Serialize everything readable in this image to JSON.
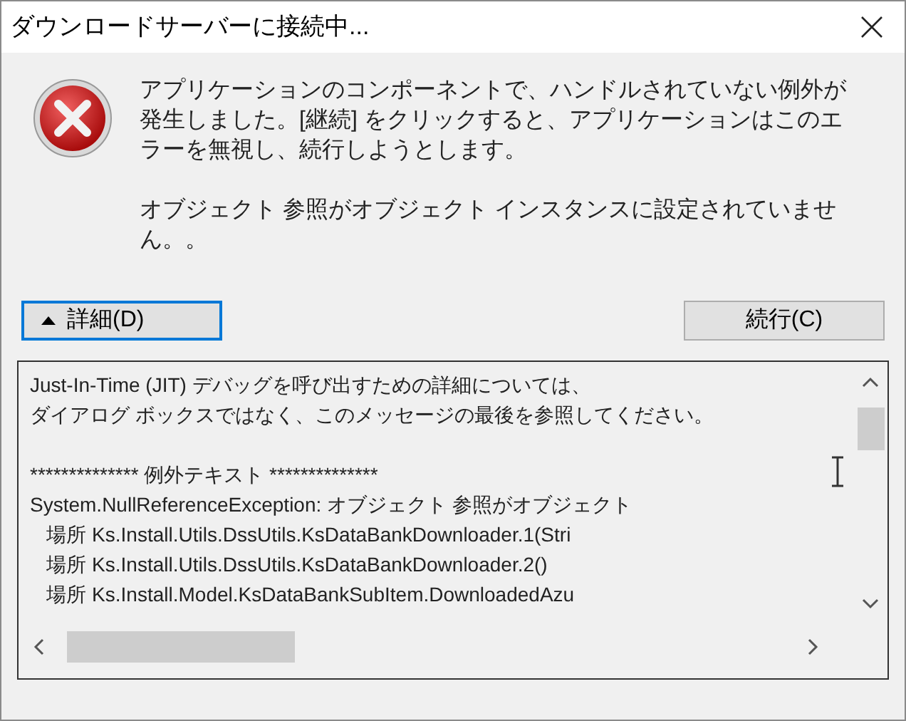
{
  "window": {
    "title": "ダウンロードサーバーに接続中..."
  },
  "message": [
    "アプリケーションのコンポーネントで、ハンドルされていない例外が発生しました。[継続] をクリックすると、アプリケーションはこのエラーを無視し、続行しようとします。",
    "オブジェクト 参照がオブジェクト インスタンスに設定されていません。。"
  ],
  "details_button": {
    "label": "詳細(D)",
    "expanded": true,
    "focused": true
  },
  "continue_button": {
    "label": "続行(C)",
    "focused": false
  },
  "details_text": [
    [
      "Just-In-Time (JIT) デバッグを呼び出すための詳細については、",
      "ダイアログ ボックスではなく、このメッセージの最後を参照してください。"
    ],
    [
      "************** 例外テキスト **************",
      "System.NullReferenceException: オブジェクト 参照がオブジェクト",
      "   場所 Ks.Install.Utils.DssUtils.KsDataBankDownloader.1(Stri",
      "   場所 Ks.Install.Utils.DssUtils.KsDataBankDownloader.2()",
      "   場所 Ks.Install.Model.KsDataBankSubItem.DownloadedAzu"
    ]
  ]
}
